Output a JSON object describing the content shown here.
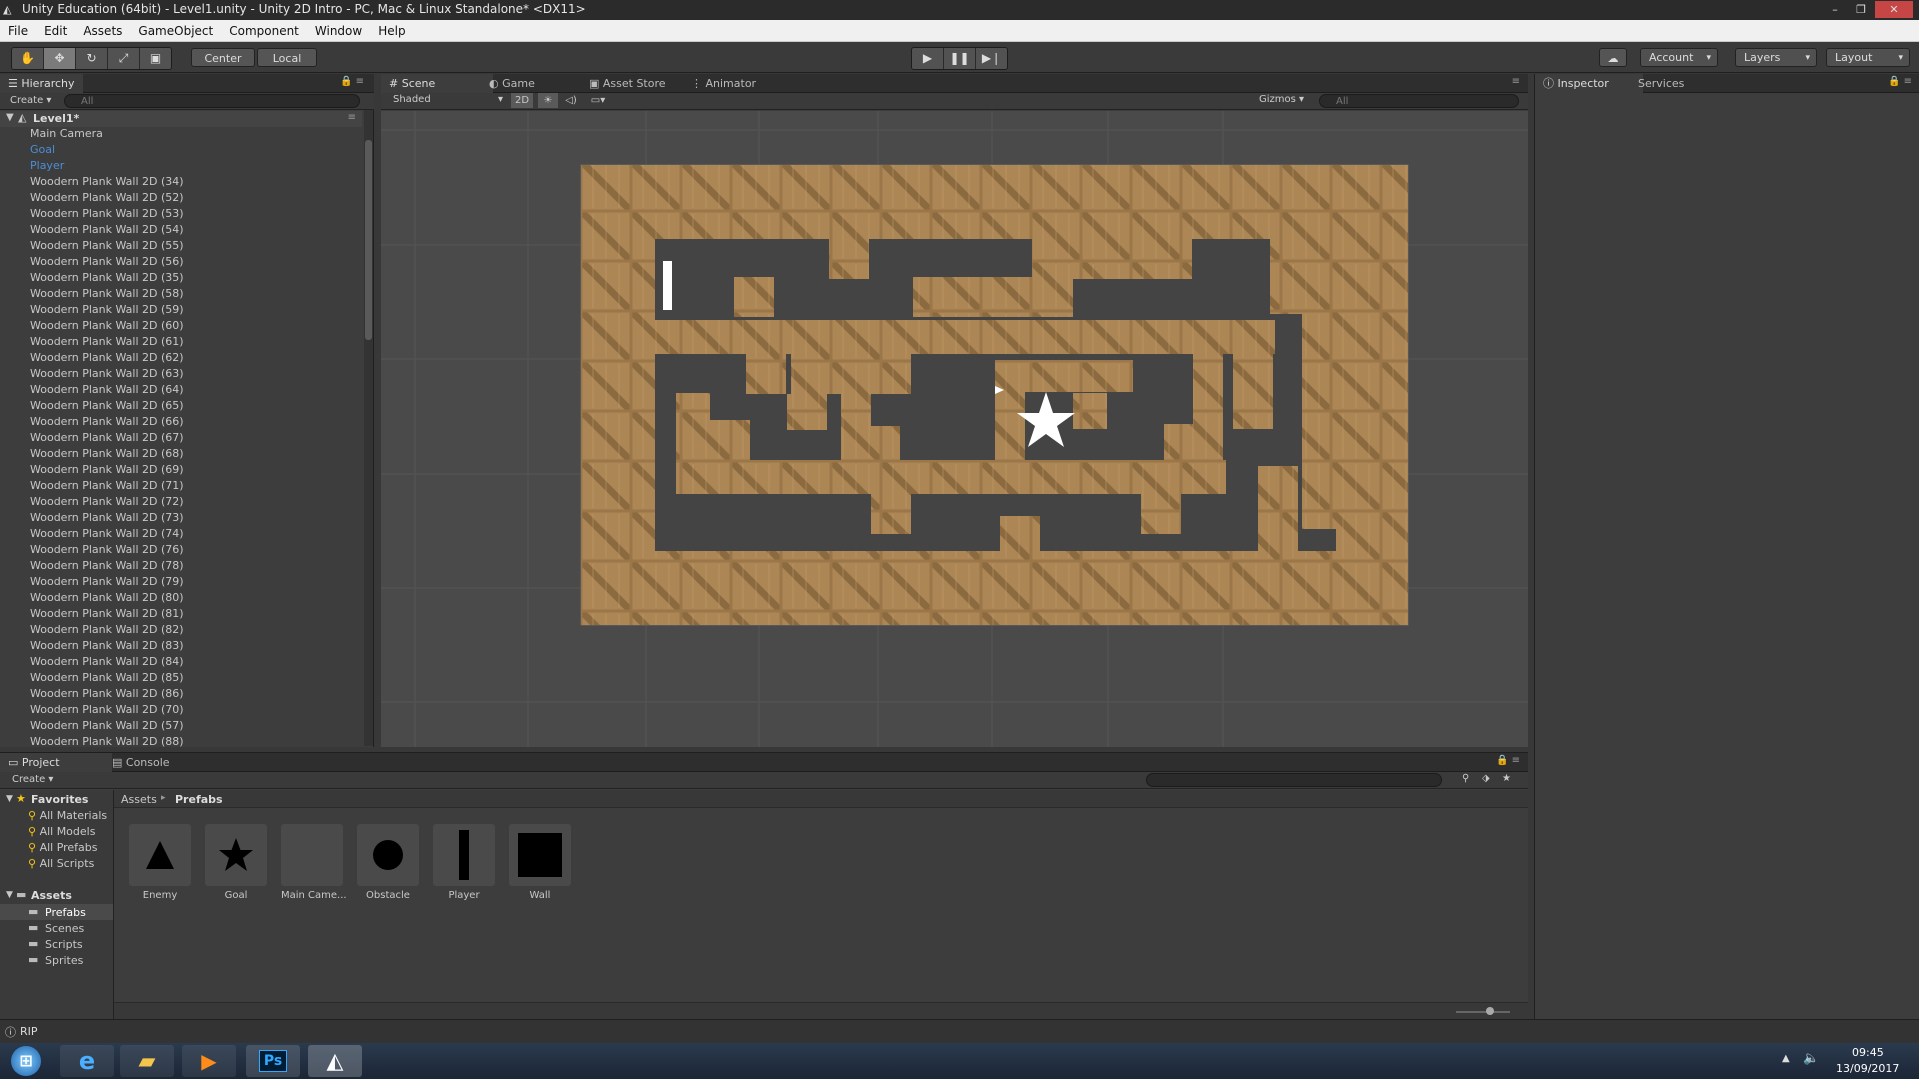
{
  "window": {
    "title": "Unity Education (64bit) - Level1.unity - Unity 2D Intro - PC, Mac & Linux Standalone* <DX11>",
    "minimize": "–",
    "maximize": "❐",
    "close": "✕"
  },
  "menu": [
    "File",
    "Edit",
    "Assets",
    "GameObject",
    "Component",
    "Window",
    "Help"
  ],
  "toolbar": {
    "pivot": "Center",
    "space": "Local",
    "account": "Account",
    "layers": "Layers",
    "layout": "Layout"
  },
  "hierarchy": {
    "tab": "Hierarchy",
    "create": "Create",
    "search_placeholder": "All",
    "scene": "Level1*",
    "items": [
      {
        "label": "Main Camera",
        "blue": false
      },
      {
        "label": "Goal",
        "blue": true
      },
      {
        "label": "Player",
        "blue": true
      },
      {
        "label": "Woodern Plank Wall 2D (34)",
        "blue": false
      },
      {
        "label": "Woodern Plank Wall 2D (52)",
        "blue": false
      },
      {
        "label": "Woodern Plank Wall 2D (53)",
        "blue": false
      },
      {
        "label": "Woodern Plank Wall 2D (54)",
        "blue": false
      },
      {
        "label": "Woodern Plank Wall 2D (55)",
        "blue": false
      },
      {
        "label": "Woodern Plank Wall 2D (56)",
        "blue": false
      },
      {
        "label": "Woodern Plank Wall 2D (35)",
        "blue": false
      },
      {
        "label": "Woodern Plank Wall 2D (58)",
        "blue": false
      },
      {
        "label": "Woodern Plank Wall 2D (59)",
        "blue": false
      },
      {
        "label": "Woodern Plank Wall 2D (60)",
        "blue": false
      },
      {
        "label": "Woodern Plank Wall 2D (61)",
        "blue": false
      },
      {
        "label": "Woodern Plank Wall 2D (62)",
        "blue": false
      },
      {
        "label": "Woodern Plank Wall 2D (63)",
        "blue": false
      },
      {
        "label": "Woodern Plank Wall 2D (64)",
        "blue": false
      },
      {
        "label": "Woodern Plank Wall 2D (65)",
        "blue": false
      },
      {
        "label": "Woodern Plank Wall 2D (66)",
        "blue": false
      },
      {
        "label": "Woodern Plank Wall 2D (67)",
        "blue": false
      },
      {
        "label": "Woodern Plank Wall 2D (68)",
        "blue": false
      },
      {
        "label": "Woodern Plank Wall 2D (69)",
        "blue": false
      },
      {
        "label": "Woodern Plank Wall 2D (71)",
        "blue": false
      },
      {
        "label": "Woodern Plank Wall 2D (72)",
        "blue": false
      },
      {
        "label": "Woodern Plank Wall 2D (73)",
        "blue": false
      },
      {
        "label": "Woodern Plank Wall 2D (74)",
        "blue": false
      },
      {
        "label": "Woodern Plank Wall 2D (76)",
        "blue": false
      },
      {
        "label": "Woodern Plank Wall 2D (78)",
        "blue": false
      },
      {
        "label": "Woodern Plank Wall 2D (79)",
        "blue": false
      },
      {
        "label": "Woodern Plank Wall 2D (80)",
        "blue": false
      },
      {
        "label": "Woodern Plank Wall 2D (81)",
        "blue": false
      },
      {
        "label": "Woodern Plank Wall 2D (82)",
        "blue": false
      },
      {
        "label": "Woodern Plank Wall 2D (83)",
        "blue": false
      },
      {
        "label": "Woodern Plank Wall 2D (84)",
        "blue": false
      },
      {
        "label": "Woodern Plank Wall 2D (85)",
        "blue": false
      },
      {
        "label": "Woodern Plank Wall 2D (86)",
        "blue": false
      },
      {
        "label": "Woodern Plank Wall 2D (70)",
        "blue": false
      },
      {
        "label": "Woodern Plank Wall 2D (57)",
        "blue": false
      },
      {
        "label": "Woodern Plank Wall 2D (88)",
        "blue": false
      }
    ]
  },
  "scene": {
    "tabs": [
      "Scene",
      "Game",
      "Asset Store",
      "Animator"
    ],
    "shading": "Shaded",
    "mode_2d": "2D",
    "gizmos": "Gizmos",
    "search_placeholder": "All"
  },
  "inspector": {
    "tab": "Inspector",
    "services": "Services"
  },
  "project": {
    "tabs": [
      "Project",
      "Console"
    ],
    "create": "Create",
    "favorites_label": "Favorites",
    "favorites": [
      "All Materials",
      "All Models",
      "All Prefabs",
      "All Scripts"
    ],
    "assets_label": "Assets",
    "folders": [
      "Prefabs",
      "Scenes",
      "Scripts",
      "Sprites"
    ],
    "breadcrumb": [
      "Assets",
      "Prefabs"
    ],
    "items": [
      {
        "label": "Enemy",
        "icon": "triangle-icon"
      },
      {
        "label": "Goal",
        "icon": "star-icon"
      },
      {
        "label": "Main Came...",
        "icon": "blank-icon"
      },
      {
        "label": "Obstacle",
        "icon": "circle-icon"
      },
      {
        "label": "Player",
        "icon": "bar-icon"
      },
      {
        "label": "Wall",
        "icon": "square-icon"
      }
    ]
  },
  "status": {
    "text": "RIP"
  },
  "taskbar": {
    "time": "09:45",
    "date": "13/09/2017",
    "ps_label": "Ps"
  },
  "colors": {
    "accent_blue": "#4b8ed6",
    "crate": "#b08a5a",
    "scene_bg": "#4a4a4a"
  }
}
